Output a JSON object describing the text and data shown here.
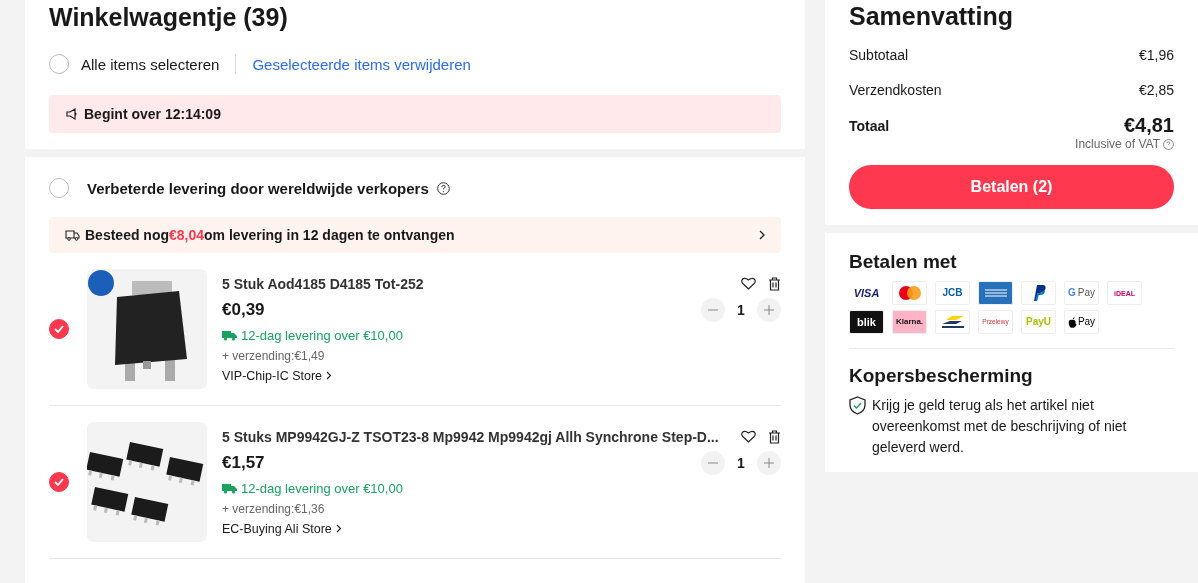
{
  "cart": {
    "title": "Winkelwagentje (39)",
    "select_all": {
      "label": "Alle items selecteren",
      "checked": false
    },
    "delete_link": "Geselecteerde items verwijderen",
    "banner": "Begint over 12:14:09"
  },
  "store_group": {
    "title": "Verbeterde levering door wereldwijde verkopers",
    "checked": false,
    "shipping_notice": {
      "before": "Besteed nog",
      "amount": "€8,04",
      "after": "om levering in 12 dagen te ontvangen"
    },
    "items": [
      {
        "title": "5 Stuk Aod4185 D4185 Tot-252",
        "price": "€0,39",
        "delivery": "12-dag levering over €10,00",
        "shipping": "+ verzending:€1,49",
        "store": "VIP-Chip-IC Store",
        "quantity": "1",
        "selected": true,
        "kind": "picture"
      },
      {
        "title": "5 Stuks MP9942GJ-Z TSOT23-8 Mp9942 Mp9942gj Allh Synchrone Step-D...",
        "price": "€1,57",
        "delivery": "12-dag levering over €10,00",
        "shipping": "+ verzending:€1,36",
        "store": "EC-Buying Ali Store",
        "quantity": "1",
        "selected": true,
        "kind": "picture"
      }
    ]
  },
  "summary": {
    "title": "Samenvatting",
    "rows": [
      {
        "label": "Subtotaal",
        "value": "€1,96"
      },
      {
        "label": "Verzendkosten",
        "value": "€2,85"
      }
    ],
    "total_label": "Totaal",
    "total_value": "€4,81",
    "vat_note": "Inclusive of VAT",
    "pay_button": "Betalen (2)"
  },
  "payment": {
    "title": "Betalen met",
    "methods": [
      {
        "kind": "visa",
        "label": "VISA"
      },
      {
        "kind": "mastercard"
      },
      {
        "kind": "jcb",
        "label": "JCB"
      },
      {
        "kind": "amex"
      },
      {
        "kind": "paypal"
      },
      {
        "kind": "gpay",
        "mark": "G",
        "label": "Pay"
      },
      {
        "kind": "ideal",
        "label": "iDEAL"
      },
      {
        "kind": "blik",
        "label": "blik"
      },
      {
        "kind": "klarna",
        "label": "Klarna."
      },
      {
        "kind": "bancontact"
      },
      {
        "kind": "przelewy",
        "label": "Przelewy"
      },
      {
        "kind": "payu",
        "label": "PayU"
      },
      {
        "kind": "applepay",
        "label": "Pay"
      }
    ]
  },
  "protection": {
    "title": "Kopersbescherming",
    "text": "Krijg je geld terug als het artikel niet overeenkomst met de beschrijving of niet geleverd werd."
  }
}
